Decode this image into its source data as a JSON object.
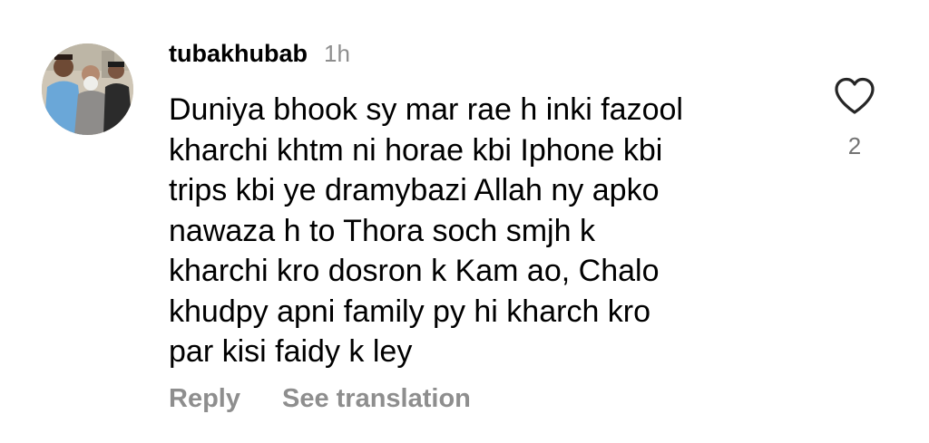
{
  "comment": {
    "username": "tubakhubab",
    "timestamp": "1h",
    "text_lines": [
      "Duniya bhook sy mar rae h inki fazool",
      "kharchi khtm ni horae kbi Iphone kbi",
      "trips kbi ye dramybazi Allah ny apko",
      "nawaza h to Thora soch smjh k",
      "kharchi kro dosron k Kam ao, Chalo",
      "khudpy apni family py hi kharch kro",
      "par kisi faidy k ley"
    ],
    "like_count": "2",
    "like_icon": "heart-outline-icon",
    "actions": {
      "reply": "Reply",
      "see_translation": "See translation"
    }
  },
  "colors": {
    "primary_text": "#000000",
    "secondary_text": "#8e8e8e",
    "icon": "#262626"
  }
}
